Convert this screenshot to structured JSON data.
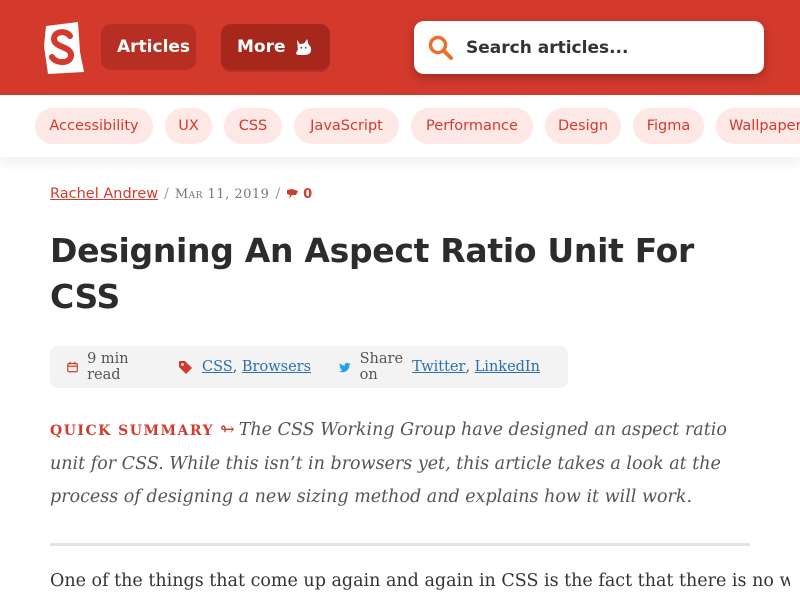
{
  "header": {
    "logo_icon": "smashing-logo-icon",
    "nav": {
      "articles_label": "Articles",
      "more_label": "More",
      "more_icon": "cat-icon"
    },
    "search": {
      "placeholder": "Search articles...",
      "icon": "search-icon"
    },
    "colors": {
      "brand": "#d33a2c",
      "tag_bg": "#fde8e6"
    }
  },
  "tags": [
    "Accessibility",
    "UX",
    "CSS",
    "JavaScript",
    "Performance",
    "Design",
    "Figma",
    "Wallpapers"
  ],
  "article": {
    "author": "Rachel Andrew",
    "date": "Mar 11, 2019",
    "comments_count": "0",
    "title": "Designing An Aspect Ratio Unit For CSS",
    "read_time": "9 min read",
    "topics": [
      "CSS",
      "Browsers"
    ],
    "share_label": "Share on",
    "share_links": [
      "Twitter",
      "LinkedIn"
    ],
    "summary_label": "Quick summary",
    "summary_text": "The CSS Working Group have designed an aspect ratio unit for CSS. While this isn’t in browsers yet, this article takes a look at the process of designing a new sizing method and explains how it will work.",
    "body_first_line": "One of the things that come up again and again in CSS is the fact that there is no way"
  }
}
